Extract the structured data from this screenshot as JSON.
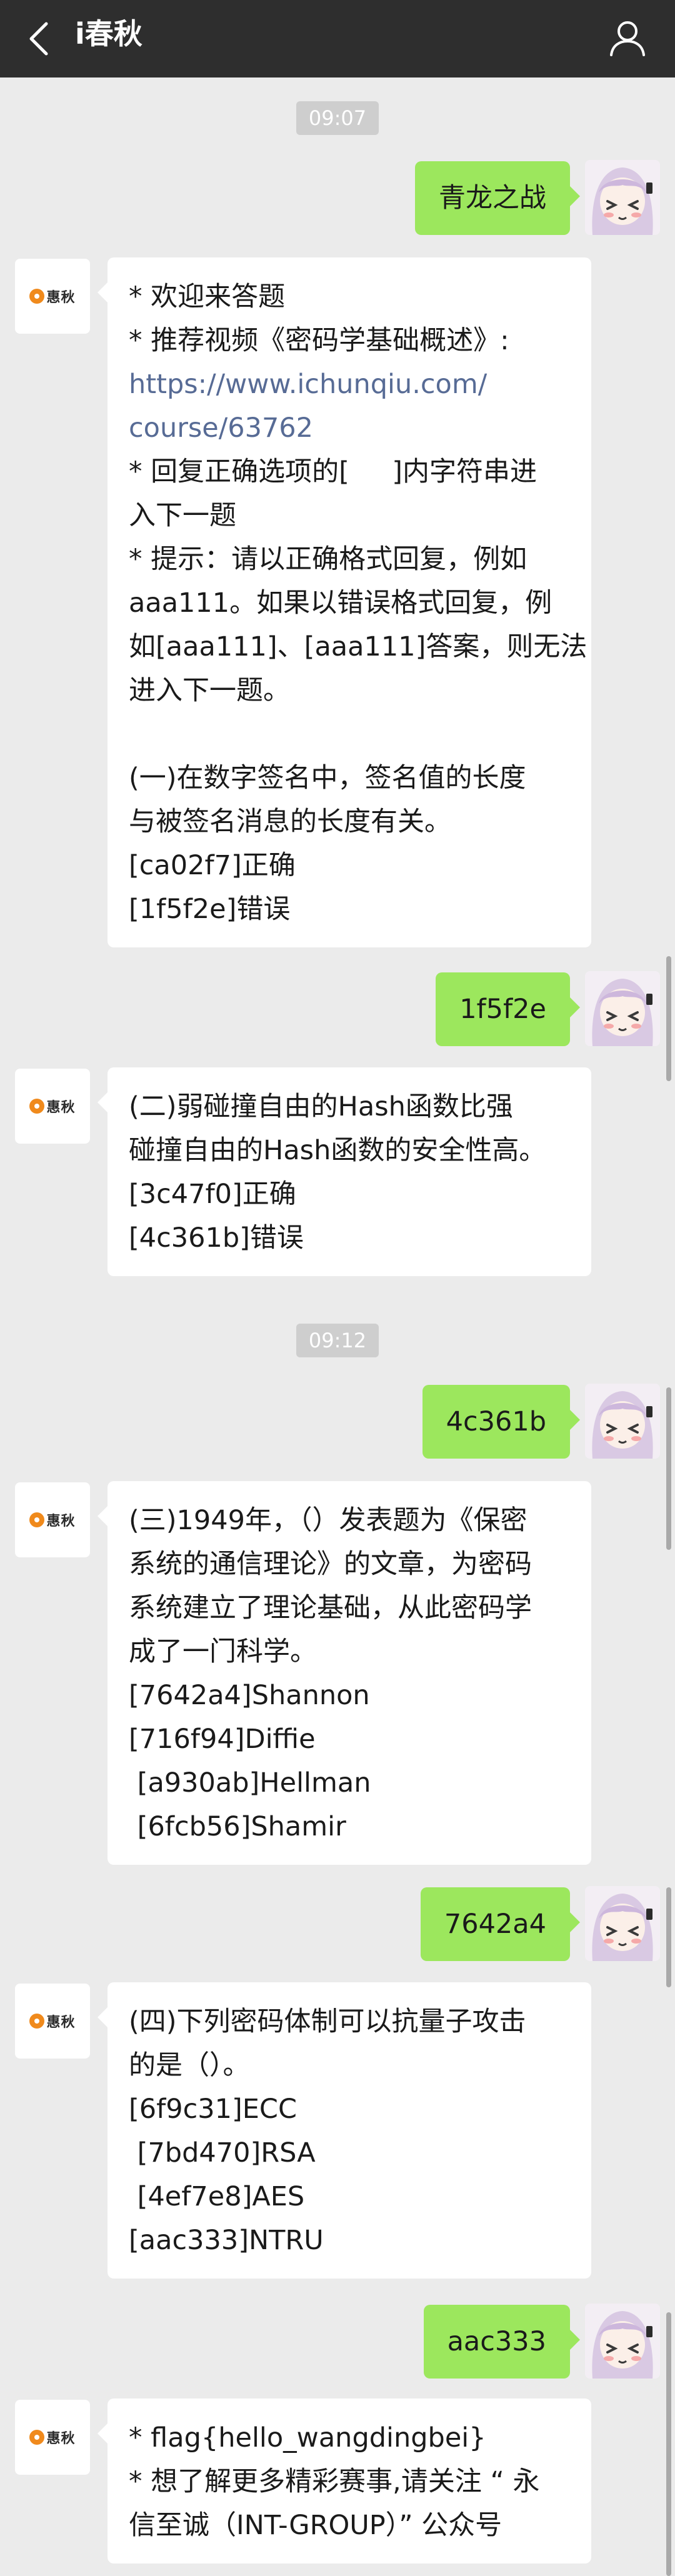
{
  "header": {
    "title": "i春秋",
    "back_icon": "chevron-left-icon",
    "profile_icon": "person-icon"
  },
  "bot": {
    "avatar_text": "惠秋"
  },
  "times": [
    "09:07",
    "09:12"
  ],
  "user_messages": [
    "青龙之战",
    "1f5f2e",
    "4c361b",
    "7642a4",
    "aac333"
  ],
  "bot_messages": [
    {
      "lines": [
        "* 欢迎来答题",
        "* 推荐视频《密码学基础概述》:",
        "https://www.ichunqiu.com/",
        "course/63762",
        "* 回复正确选项的[     ]内字符串进",
        "入下一题",
        "* 提示：请以正确格式回复，例如",
        "aaa111。如果以错误格式回复，例",
        "如[aaa111]、[aaa111]答案，则无法",
        "进入下一题。",
        "",
        "(一)在数字签名中，签名值的长度",
        "与被签名消息的长度有关。",
        "[ca02f7]正确",
        "[1f5f2e]错误"
      ]
    },
    {
      "lines": [
        "(二)弱碰撞自由的Hash函数比强",
        "碰撞自由的Hash函数的安全性高。",
        "[3c47f0]正确",
        "[4c361b]错误"
      ]
    },
    {
      "lines": [
        "(三)1949年，（）发表题为《保密",
        "系统的通信理论》的文章，为密码",
        "系统建立了理论基础，从此密码学",
        "成了一门科学。",
        "[7642a4]Shannon",
        "[716f94]Diffie",
        " [a930ab]Hellman",
        " [6fcb56]Shamir"
      ]
    },
    {
      "lines": [
        "(四)下列密码体制可以抗量子攻击",
        "的是（）。",
        "[6f9c31]ECC",
        " [7bd470]RSA",
        " [4ef7e8]AES",
        "[aac333]NTRU"
      ]
    },
    {
      "lines": [
        "* flag{hello_wangdingbei}",
        "* 想了解更多精彩赛事,请关注 “ 永",
        "信至诚（INT-GROUP）” 公众号"
      ]
    }
  ],
  "colors": {
    "header_bg": "#2e2e2e",
    "chat_bg": "#ebebeb",
    "user_bubble": "#9ce75d",
    "bot_bubble": "#ffffff",
    "link": "#576b95",
    "time_chip": "#cecece"
  }
}
